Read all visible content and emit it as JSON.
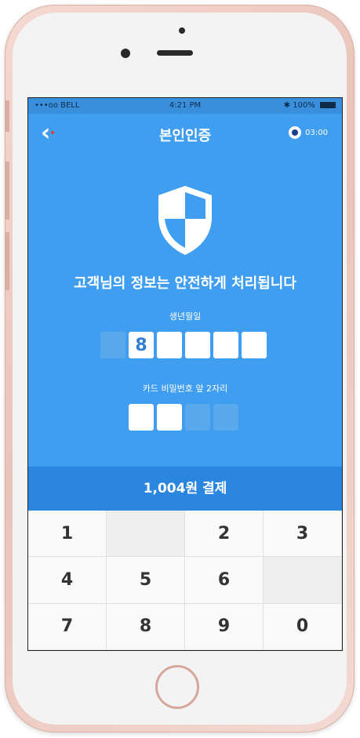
{
  "status_bar": {
    "carrier": "•••oo BELL",
    "time": "4:21 PM",
    "battery": "100%"
  },
  "header": {
    "title": "본인인증",
    "timer": "03:00"
  },
  "main": {
    "headline": "고객님의 정보는 안전하게 처리됩니다",
    "birth_label": "생년월일",
    "birth_digits": [
      "",
      "8",
      "",
      "",
      "",
      ""
    ],
    "card_label": "카드 비밀번호 앞 2자리",
    "card_digits": [
      "",
      "",
      "",
      ""
    ]
  },
  "pay_button": "1,004원 결제",
  "keypad": {
    "keys": [
      "1",
      "",
      "2",
      "3",
      "4",
      "5",
      "6",
      "",
      "7",
      "8",
      "9",
      "0"
    ]
  },
  "colors": {
    "primary": "#3f9ef0",
    "pay_bar": "#2a86df",
    "phone_body": "#eac3b9"
  },
  "icons": {
    "back": "chevron-left-icon",
    "timer": "timer-icon",
    "shield": "shield-icon"
  }
}
